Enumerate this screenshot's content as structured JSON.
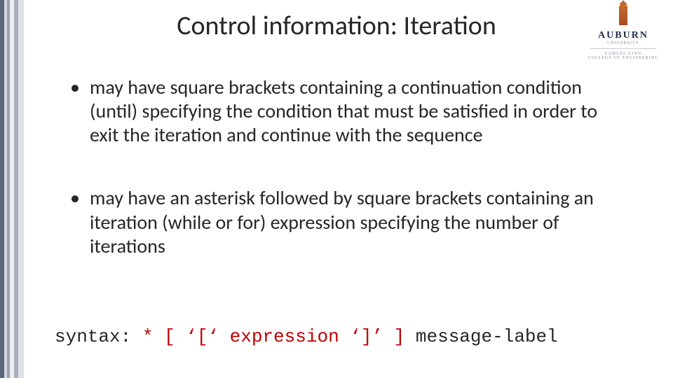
{
  "title": "Control information: Iteration",
  "logo": {
    "name": "AUBURN",
    "sub1": "UNIVERSITY",
    "sub2": "Samuel Ginn",
    "sub3": "College of Engineering"
  },
  "bullets": [
    "may have square brackets containing a continuation condition (until) specifying the condition that must be satisfied in order to exit the iteration and continue with the sequence",
    "may have an asterisk followed by square brackets containing an iteration (while or for) expression specifying the number of iterations"
  ],
  "syntax": {
    "prefix": "syntax: ",
    "red_part": "* [ ‘[‘ expression ‘]’ ]",
    "suffix": " message-label"
  }
}
